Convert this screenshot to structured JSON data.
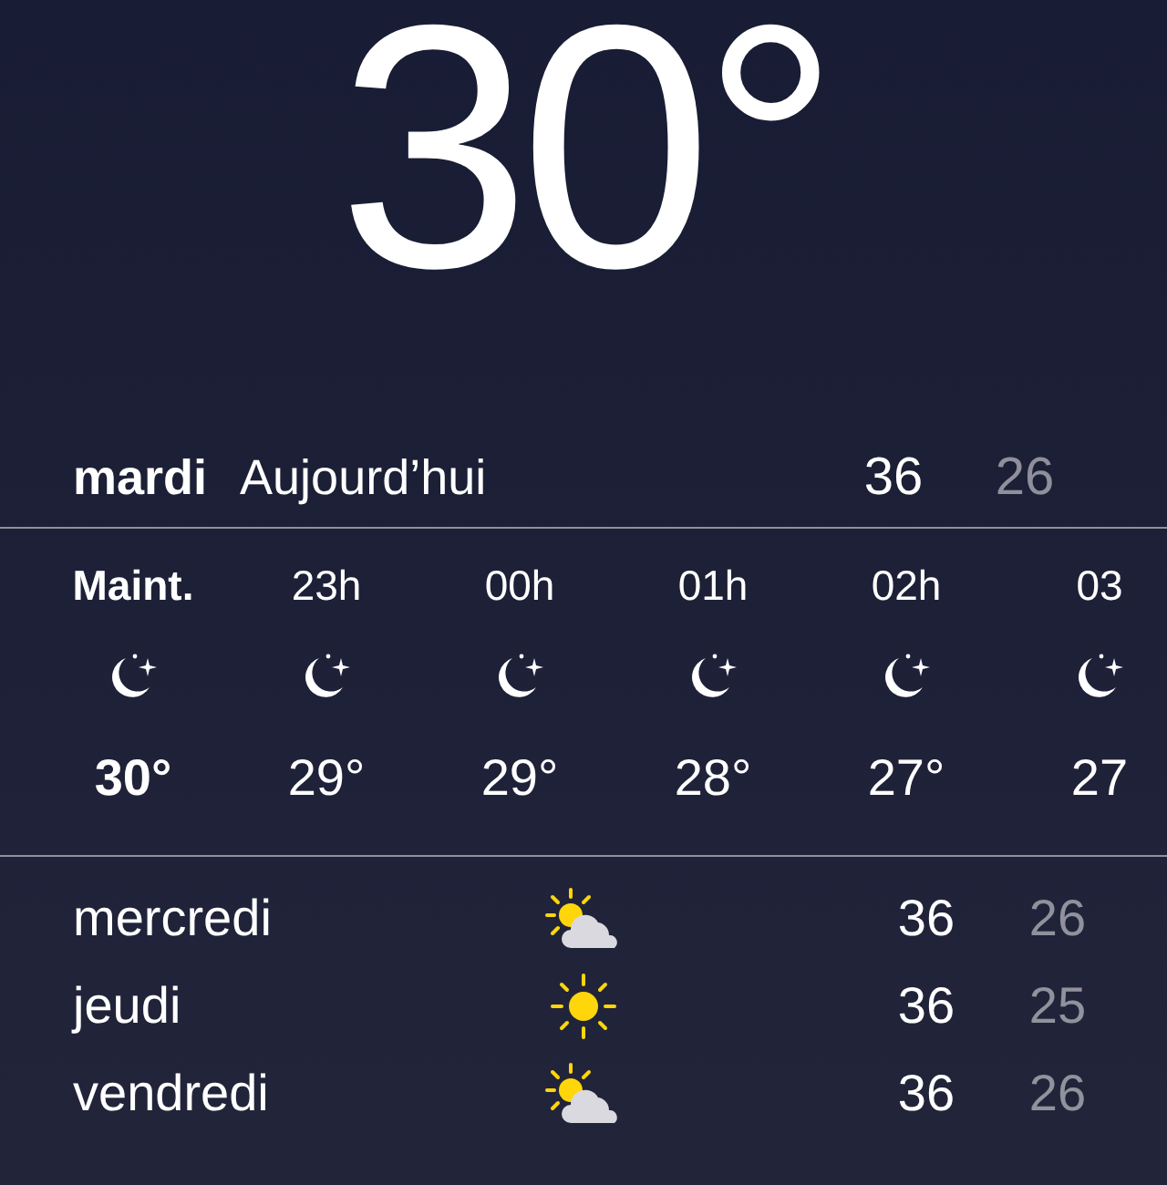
{
  "current": {
    "temperature": "30°"
  },
  "today": {
    "day": "mardi",
    "label": "Aujourd’hui",
    "high": "36",
    "low": "26"
  },
  "hourly": [
    {
      "kind": "moon",
      "emphasized": true,
      "time": "Maint.",
      "temp": "30°"
    },
    {
      "kind": "moon",
      "emphasized": false,
      "time": "23h",
      "temp": "29°"
    },
    {
      "kind": "moon",
      "emphasized": false,
      "time": "00h",
      "temp": "29°"
    },
    {
      "kind": "moon",
      "emphasized": false,
      "time": "01h",
      "temp": "28°"
    },
    {
      "kind": "moon",
      "emphasized": false,
      "time": "02h",
      "temp": "27°"
    },
    {
      "kind": "moon",
      "emphasized": false,
      "time": "03",
      "temp": "27"
    }
  ],
  "daily": [
    {
      "kind": "partly_sunny",
      "day": "mercredi",
      "high": "36",
      "low": "26"
    },
    {
      "kind": "sunny",
      "day": "jeudi",
      "high": "36",
      "low": "25"
    },
    {
      "kind": "partly_sunny",
      "day": "vendredi",
      "high": "36",
      "low": "26"
    }
  ]
}
